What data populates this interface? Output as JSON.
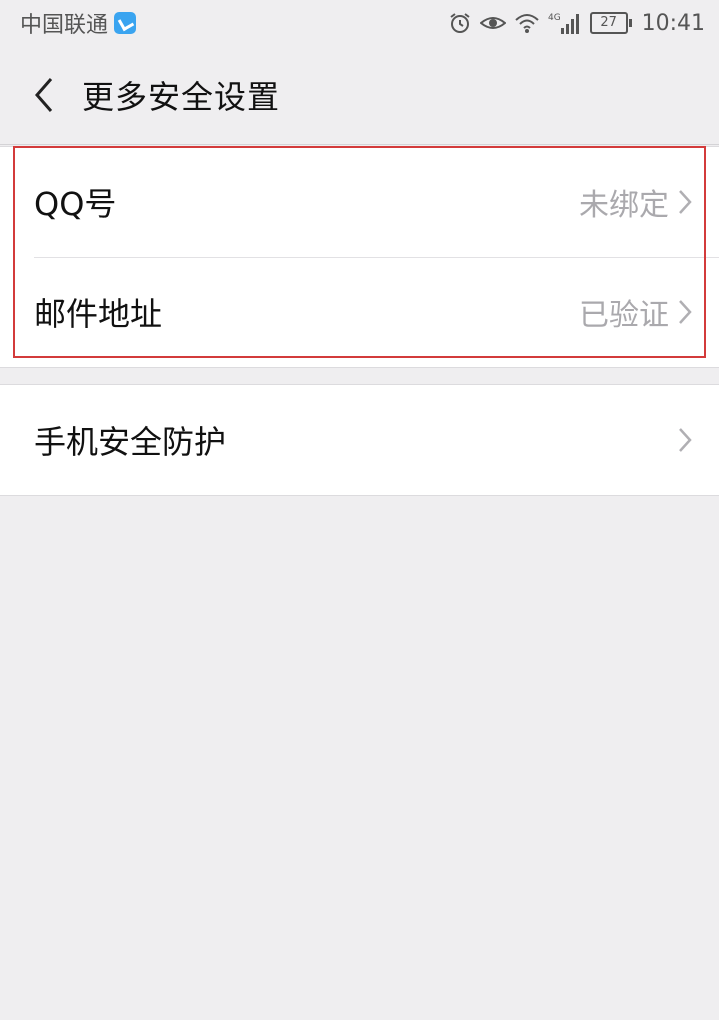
{
  "status_bar": {
    "carrier": "中国联通",
    "network": "4G",
    "battery": "27",
    "time": "10:41"
  },
  "header": {
    "title": "更多安全设置"
  },
  "groups": [
    {
      "rows": [
        {
          "label": "QQ号",
          "value": "未绑定"
        },
        {
          "label": "邮件地址",
          "value": "已验证"
        }
      ]
    },
    {
      "rows": [
        {
          "label": "手机安全防护",
          "value": ""
        }
      ]
    }
  ],
  "colors": {
    "background": "#efeef0",
    "highlight_border": "#d33b3b",
    "secondary_text": "#aaa9ad"
  }
}
